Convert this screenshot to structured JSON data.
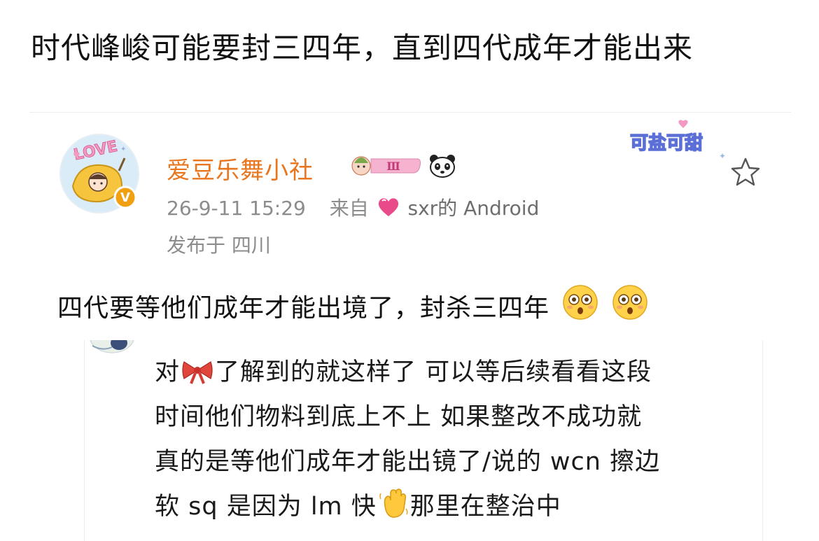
{
  "headline": "时代峰峻可能要封三四年，直到四代成年才能出来",
  "post": {
    "username": "爱豆乐舞小社",
    "level_badge": "Ⅲ",
    "timestamp": "26-9-11 15:29",
    "source_prefix": "来自",
    "source_name": "sxr的 Android",
    "location": "发布于 四川",
    "sticker_text": "可盐可甜",
    "avatar_text": "LOVE",
    "text": "四代要等他们成年才能出境了，封杀三四年"
  },
  "quote": {
    "line1_a": "对",
    "line1_b": "了解到的就这样了 可以等后续看看这段",
    "line2": "时间他们物料到底上不上 如果整改不成功就",
    "line3": "真的是等他们成年才能出镜了/说的 wcn 擦边",
    "line4_a": "软 sq 是因为 lm 快",
    "line4_b": "那里在整治中"
  },
  "colors": {
    "username": "#e8761e",
    "meta": "#8c8c8c",
    "sticker": "#5b6fd6",
    "heart": "#e84a8a"
  },
  "icons": {
    "avatar": "love-mango-avatar",
    "verified": "verified-v-badge",
    "level": "level-badge",
    "panda": "panda-icon",
    "heart": "pink-heart-icon",
    "star": "favorite-star-icon",
    "emoji": "flushed-face-emoji",
    "bow": "red-bow-icon",
    "hand": "waving-hand-icon"
  }
}
